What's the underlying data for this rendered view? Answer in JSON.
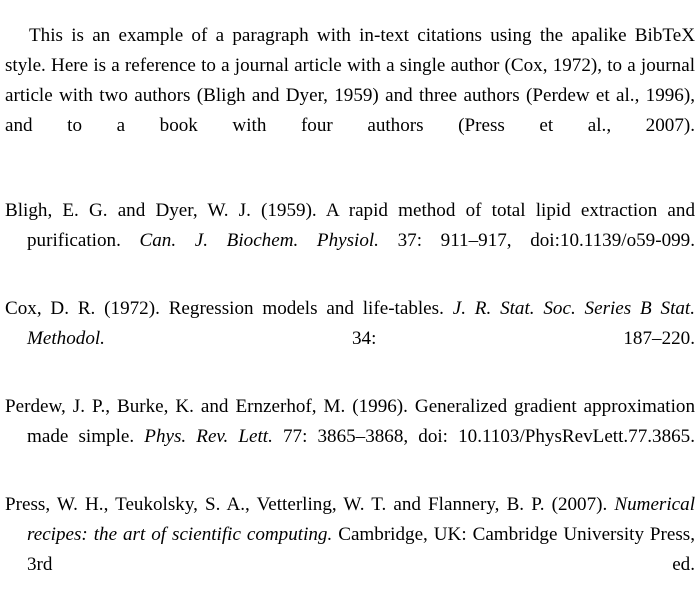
{
  "document": {
    "background_color": "#ffffff",
    "text_color": "#000000"
  },
  "body": {
    "paragraph": "This is an example of a paragraph with in-text citations using the apalike BibTeX style. Here is a reference to a journal article with a single author (Cox, 1972), to a journal article with two authors (Bligh and Dyer, 1959) and three authors (Perdew et al., 1996), and to a book with four authors (Press et al., 2007)."
  },
  "bibliography": {
    "entries": [
      {
        "id": "bligh1959",
        "authors_year": "Bligh, E. G. and Dyer, W. J. (1959).",
        "title": "A rapid method of total lipid extraction and purification.",
        "journal": "Can. J. Biochem. Physiol.",
        "details": "37: 911–917, doi:10.1139/o59-099."
      },
      {
        "id": "cox1972",
        "authors_year": "Cox, D. R. (1972).",
        "title": "Regression models and life-tables.",
        "journal": "J. R. Stat. Soc. Series B Stat. Methodol.",
        "details": "34: 187–220."
      },
      {
        "id": "perdew1996",
        "authors_year": "Perdew, J. P., Burke, K. and Ernzerhof, M. (1996).",
        "title": "Generalized gradient approximation made simple.",
        "journal": "Phys. Rev. Lett.",
        "details": "77: 3865–3868, doi: 10.1103/PhysRevLett.77.3865."
      },
      {
        "id": "press2007",
        "authors_year": "Press, W. H., Teukolsky, S. A., Vetterling, W. T. and Flannery, B. P. (2007).",
        "title": "Numerical recipes: the art of scientific computing.",
        "journal": "",
        "details": "Cambridge, UK: Cambridge University Press, 3rd ed."
      }
    ]
  }
}
